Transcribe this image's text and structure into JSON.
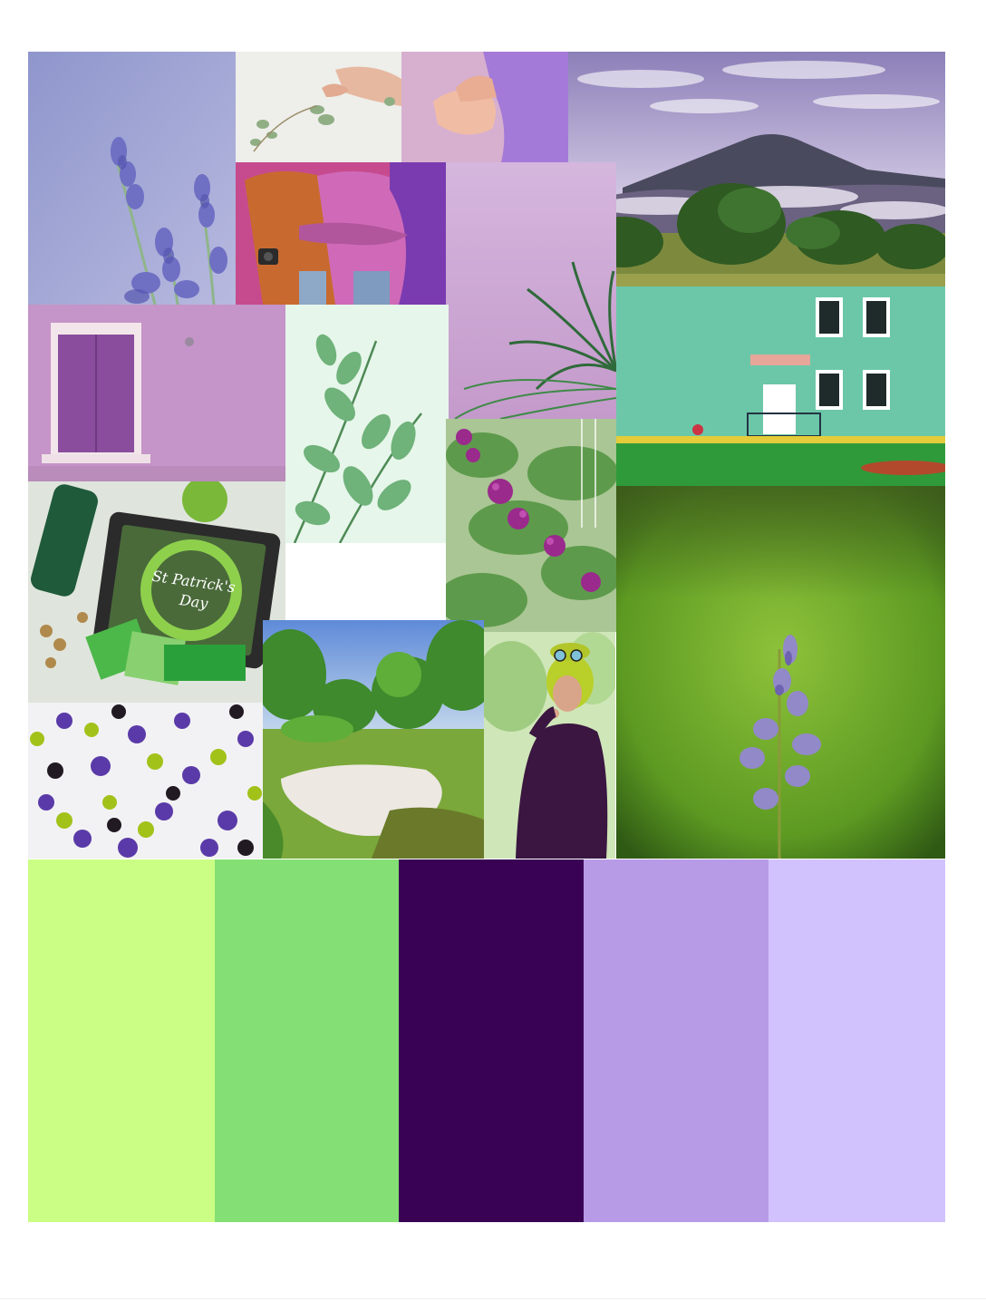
{
  "palette": {
    "swatches": [
      {
        "name": "lime",
        "color": "#cbfe84"
      },
      {
        "name": "green",
        "color": "#84e074"
      },
      {
        "name": "deep-purple",
        "color": "#390255"
      },
      {
        "name": "lavender",
        "color": "#b89be6"
      },
      {
        "name": "pale-lavender",
        "color": "#d1c2fe"
      }
    ]
  },
  "tablet_text": {
    "line1": "St Patrick's",
    "line2": "Day"
  },
  "colors": {
    "lavender_bg": "#9fa3d6",
    "mint_wall": "#6cc7a8",
    "grass": "#2f9a3a",
    "pink_wall": "#c99acb",
    "lilac_wall": "#cba6d6"
  }
}
